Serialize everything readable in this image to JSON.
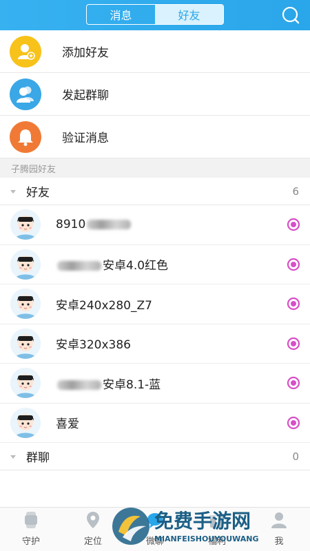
{
  "header": {
    "tabs": [
      "消息",
      "好友"
    ],
    "active_tab": "好友",
    "search_icon": "search-icon"
  },
  "actions": [
    {
      "label": "添加好友",
      "icon": "add-friend-icon",
      "color": "#f7c21a"
    },
    {
      "label": "发起群聊",
      "icon": "group-chat-icon",
      "color": "#3aa7e6"
    },
    {
      "label": "验证消息",
      "icon": "bell-icon",
      "color": "#f07a35"
    }
  ],
  "section_title": "子腾园好友",
  "groups": [
    {
      "name": "好友",
      "count": "6"
    },
    {
      "name": "群聊",
      "count": "0"
    }
  ],
  "friends": [
    {
      "prefix": "8910",
      "suffix": "",
      "blurred": true
    },
    {
      "prefix": "",
      "suffix": "安卓4.0红色",
      "blurred": true
    },
    {
      "prefix": "安卓240x280_Z7",
      "suffix": "",
      "blurred": false
    },
    {
      "prefix": "安卓320x386",
      "suffix": "",
      "blurred": false
    },
    {
      "prefix": "",
      "suffix": "安卓8.1-蓝",
      "blurred": true
    },
    {
      "prefix": "喜爱",
      "suffix": "",
      "blurred": false
    }
  ],
  "tabbar": [
    {
      "label": "守护",
      "icon": "watch-icon"
    },
    {
      "label": "定位",
      "icon": "location-pin-icon"
    },
    {
      "label": "微聊",
      "icon": "chat-icon"
    },
    {
      "label": "福利",
      "icon": "gift-icon"
    },
    {
      "label": "我",
      "icon": "profile-icon"
    }
  ],
  "watermark": {
    "title": "免费手游网",
    "subtitle": "MIANFEISHOUYOUWANG"
  },
  "colors": {
    "header": "#2aa6ea",
    "online_mark": "#d84fc7",
    "divider": "#e6e6e6"
  }
}
